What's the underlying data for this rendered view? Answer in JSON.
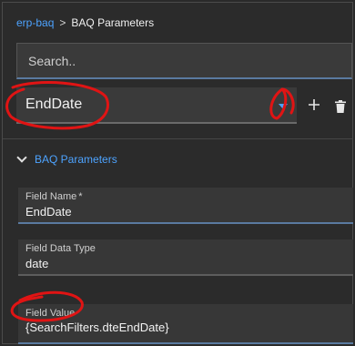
{
  "breadcrumb": {
    "root": "erp-baq",
    "separator": ">",
    "current": "BAQ Parameters"
  },
  "search": {
    "placeholder": "Search.."
  },
  "param_selector": {
    "value": "EndDate",
    "add_icon": "plus-icon",
    "delete_icon": "trash-icon"
  },
  "section": {
    "title": "BAQ Parameters"
  },
  "fields": [
    {
      "label": "Field Name",
      "required_mark": "*",
      "value": "EndDate"
    },
    {
      "label": "Field Data Type",
      "value": "date"
    },
    {
      "label": "Field Value",
      "value": "{SearchFilters.dteEndDate}"
    }
  ],
  "colors": {
    "accent": "#4da3ff",
    "annotation": "#e01414"
  }
}
